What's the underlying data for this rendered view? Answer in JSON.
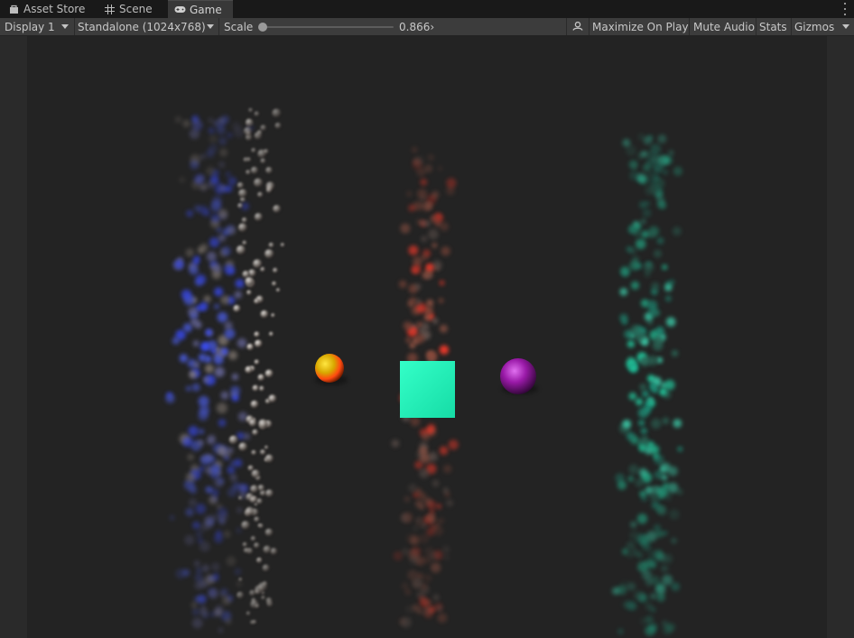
{
  "tabs": [
    {
      "label": "Asset Store",
      "icon": "asset-store-icon"
    },
    {
      "label": "Scene",
      "icon": "scene-grid-icon"
    },
    {
      "label": "Game",
      "icon": "gamepad-icon"
    }
  ],
  "toolbar": {
    "display": "Display 1",
    "resolution": "Standalone (1024x768)",
    "scale_label": "Scale",
    "scale_value": "0.866›",
    "scale_fraction": 0.0,
    "audio_icon": "audio-listener-icon",
    "maximize_on_play": "Maximize On Play",
    "mute_audio": "Mute Audio",
    "stats": "Stats",
    "gizmos": "Gizmos"
  },
  "scene": {
    "objects": [
      {
        "name": "yellow-orange-sphere",
        "color": "#ff9a10"
      },
      {
        "name": "teal-cube",
        "color": "#22f0b8"
      },
      {
        "name": "purple-sphere",
        "color": "#9a1aa8"
      }
    ],
    "particle_systems": [
      {
        "name": "blue-white-particles",
        "color": "#3a4dff"
      },
      {
        "name": "red-particles",
        "color": "#ff3a2a"
      },
      {
        "name": "teal-particles",
        "color": "#20d8a8"
      }
    ]
  }
}
